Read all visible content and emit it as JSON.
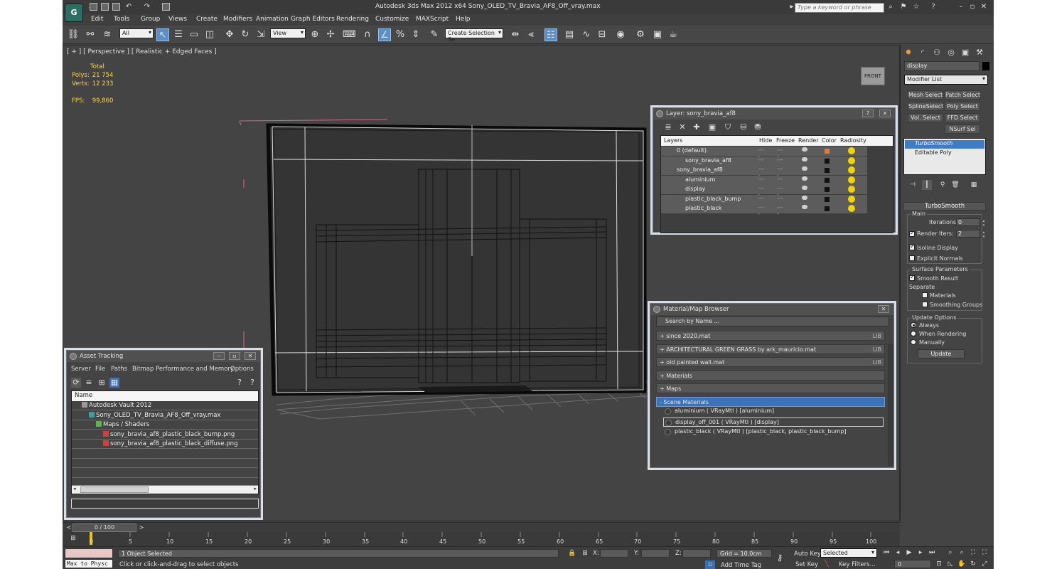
{
  "app": {
    "title": "Autodesk 3ds Max  2012 x64     Sony_OLED_TV_Bravia_AF8_Off_vray.max",
    "logo": "3ds-max-logo",
    "search_placeholder": "Type a keyword or phrase"
  },
  "menu": [
    "Edit",
    "Tools",
    "Group",
    "Views",
    "Create",
    "Modifiers",
    "Animation",
    "Graph Editors",
    "Rendering",
    "Customize",
    "MAXScript",
    "Help"
  ],
  "toolbar": {
    "selection_filter": "All",
    "ref_coord": "View",
    "named_selection": "Create Selection Se"
  },
  "viewport": {
    "label": "[ + ] [ Perspective ] [ Realistic + Edged Faces ]",
    "stats": {
      "total_label": "Total",
      "polys_label": "Polys:",
      "polys_value": "21 754",
      "verts_label": "Verts:",
      "verts_value": "12 233",
      "fps_label": "FPS:",
      "fps_value": "99,860"
    },
    "viewcube_label": "FRONT"
  },
  "layer_dialog": {
    "title": "Layer: sony_bravia_af8",
    "columns": [
      "Layers",
      "Hide",
      "Freeze",
      "Render",
      "Color",
      "Radiosity"
    ],
    "rows": [
      {
        "name": "0 (default)",
        "indent": 0,
        "color": "#e07a3b"
      },
      {
        "name": "sony_bravia_af8",
        "indent": 1,
        "color": "#111111"
      },
      {
        "name": "sony_bravia_af8",
        "indent": 0,
        "color": "#111111"
      },
      {
        "name": "aluminium",
        "indent": 1,
        "color": "#111111"
      },
      {
        "name": "display",
        "indent": 1,
        "color": "#111111"
      },
      {
        "name": "plastic_black_bump",
        "indent": 1,
        "color": "#111111"
      },
      {
        "name": "plastic_black",
        "indent": 1,
        "color": "#111111"
      }
    ],
    "dash": "----"
  },
  "material_browser": {
    "title": "Material/Map Browser",
    "search_placeholder": "Search by Name ...",
    "libraries": [
      {
        "label": "+ since 2020.mat",
        "tag": "LIB"
      },
      {
        "label": "+ ARCHITECTURAL GREEN GRASS by ark_mauricio.mat",
        "tag": "LIB"
      },
      {
        "label": "+ old painted wall.mat",
        "tag": "LIB"
      },
      {
        "label": "+ Materials",
        "tag": ""
      },
      {
        "label": "+ Maps",
        "tag": ""
      },
      {
        "label": "- Scene Materials",
        "tag": ""
      }
    ],
    "materials": [
      "aluminium  ( VRayMtl )  [aluminium]",
      "display_off_001  ( VRayMtl )  [display]",
      "plastic_black  ( VRayMtl )  [plastic_black, plastic_black_bump]"
    ]
  },
  "asset_tracking": {
    "title": "Asset Tracking",
    "menu": [
      "Server",
      "File",
      "Paths",
      "Bitmap Performance and Memory",
      "Options"
    ],
    "column": "Name",
    "rows": [
      {
        "name": "Autodesk Vault 2012",
        "indent": 0
      },
      {
        "name": "Sony_OLED_TV_Bravia_AF8_Off_vray.max",
        "indent": 1
      },
      {
        "name": "Maps / Shaders",
        "indent": 2
      },
      {
        "name": "sony_bravia_af8_plastic_black_bump.png",
        "indent": 3
      },
      {
        "name": "sony_bravia_af8_plastic_black_diffuse.png",
        "indent": 3
      }
    ]
  },
  "command_panel": {
    "object_name": "display",
    "modifier_list": "Modifier List",
    "buttons": [
      "Mesh Select",
      "Patch Select",
      "SplineSelect",
      "Poly Select",
      "Vol. Select",
      "FFD Select",
      "",
      "NSurf Sel"
    ],
    "stack": [
      "TurboSmooth",
      "Editable Poly"
    ],
    "rollout": "TurboSmooth",
    "main_group": "Main",
    "iterations_label": "Iterations:",
    "iterations": "0",
    "render_iters_label": "Render Iters:",
    "render_iters": "2",
    "isoline": "Isoline Display",
    "explicit_normals": "Explicit Normals",
    "surface_group": "Surface Parameters",
    "smooth_result": "Smooth Result",
    "separate": "Separate",
    "materials": "Materials",
    "smoothing_groups": "Smoothing Groups",
    "update_group": "Update Options",
    "always": "Always",
    "when_rendering": "When Rendering",
    "manually": "Manually",
    "update": "Update"
  },
  "timeline": {
    "frame": "0 / 100",
    "ticks": [
      "0",
      "5",
      "10",
      "15",
      "20",
      "25",
      "30",
      "35",
      "40",
      "45",
      "50",
      "55",
      "60",
      "65",
      "70",
      "75",
      "80",
      "85",
      "90",
      "95",
      "100"
    ]
  },
  "status": {
    "maxscript": "Max to Physc",
    "selected": "1 Object Selected",
    "prompt": "Click or click-and-drag to select objects",
    "x_label": "X:",
    "y_label": "Y:",
    "z_label": "Z:",
    "grid": "Grid = 10,0cm",
    "add_time_tag": "Add Time Tag",
    "auto_key": "Auto Key",
    "set_key": "Set Key",
    "key_mode": "Selected",
    "key_filters": "Key Filters...",
    "frame_field": "0"
  }
}
